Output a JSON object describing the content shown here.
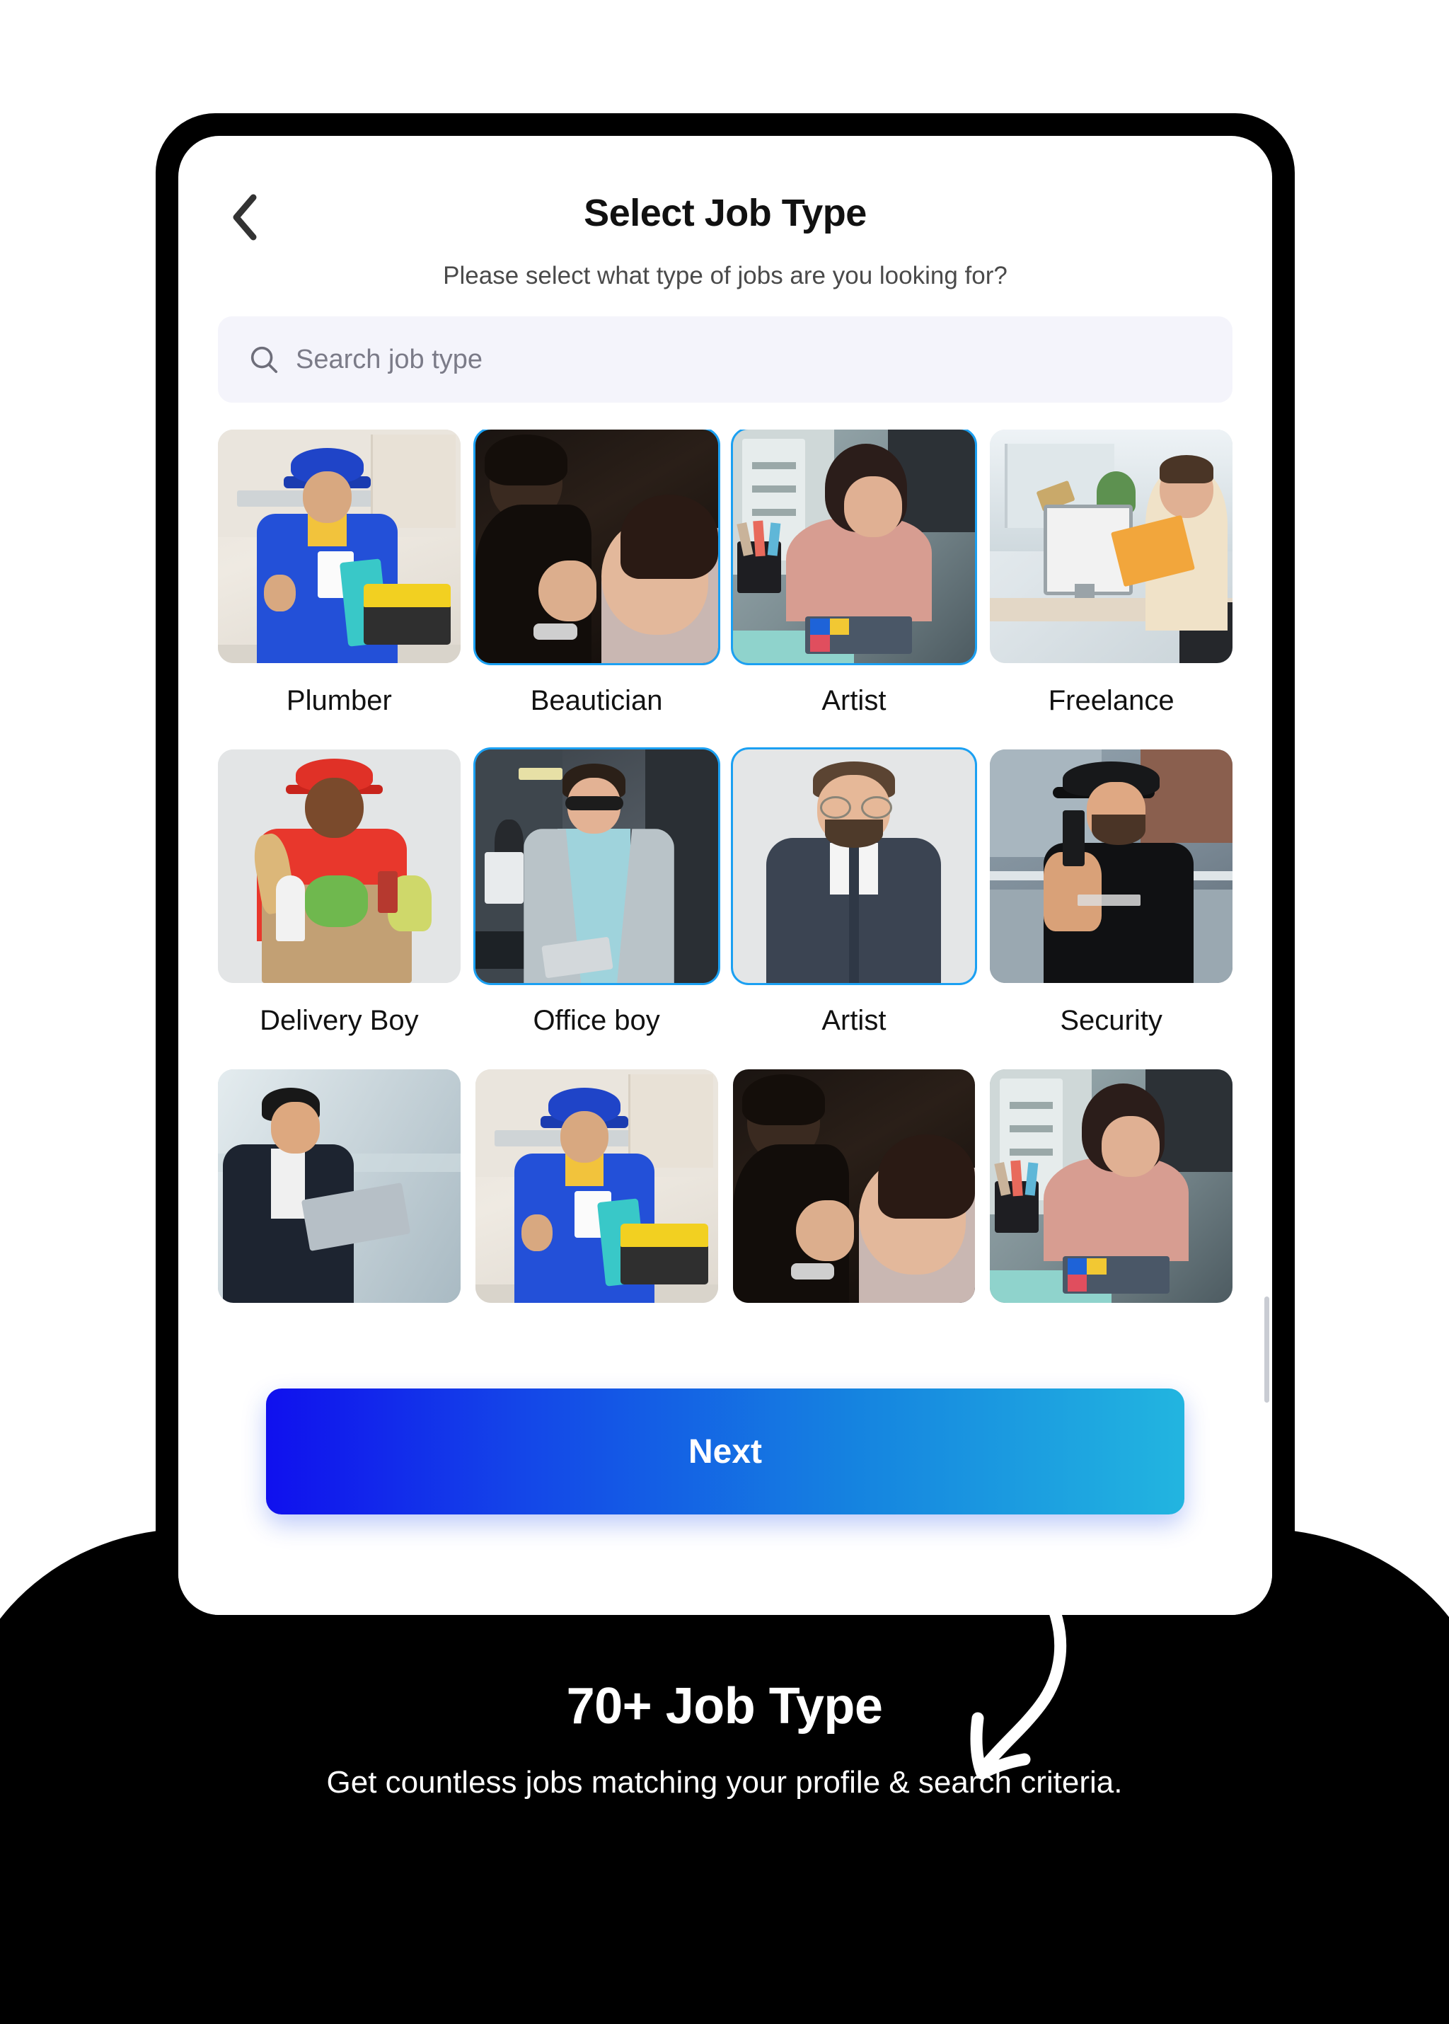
{
  "header": {
    "back_icon": "chevron-left-icon",
    "title": "Select Job Type",
    "subtitle": "Please select what type of jobs are you looking for?"
  },
  "search": {
    "icon": "search-icon",
    "placeholder": "Search job type",
    "value": ""
  },
  "job_types": [
    {
      "label": "Plumber",
      "selected": false,
      "art": "a-plumber"
    },
    {
      "label": "Beautician",
      "selected": true,
      "art": "a-beaut"
    },
    {
      "label": "Artist",
      "selected": true,
      "art": "a-artist"
    },
    {
      "label": "Freelance",
      "selected": false,
      "art": "a-free"
    },
    {
      "label": "Delivery Boy",
      "selected": false,
      "art": "a-deliv"
    },
    {
      "label": "Office boy",
      "selected": true,
      "art": "a-office"
    },
    {
      "label": "Artist",
      "selected": true,
      "art": "a-man"
    },
    {
      "label": "Security",
      "selected": false,
      "art": "a-sec"
    },
    {
      "label": "",
      "selected": false,
      "art": "a-biz"
    },
    {
      "label": "",
      "selected": false,
      "art": "a-plumber"
    },
    {
      "label": "",
      "selected": false,
      "art": "a-beaut"
    },
    {
      "label": "",
      "selected": false,
      "art": "a-artist"
    }
  ],
  "primary_action": {
    "label": "Next"
  },
  "footer": {
    "headline": "70+ Job Type",
    "tagline": "Get countless jobs matching your profile & search criteria.",
    "arrow_icon": "curved-arrow-down-icon"
  },
  "colors": {
    "accent_start": "#1010ee",
    "accent_end": "#22b5e0",
    "selected_border": "#1ba0f2",
    "search_bg": "#f4f4fb",
    "frame": "#000000"
  }
}
